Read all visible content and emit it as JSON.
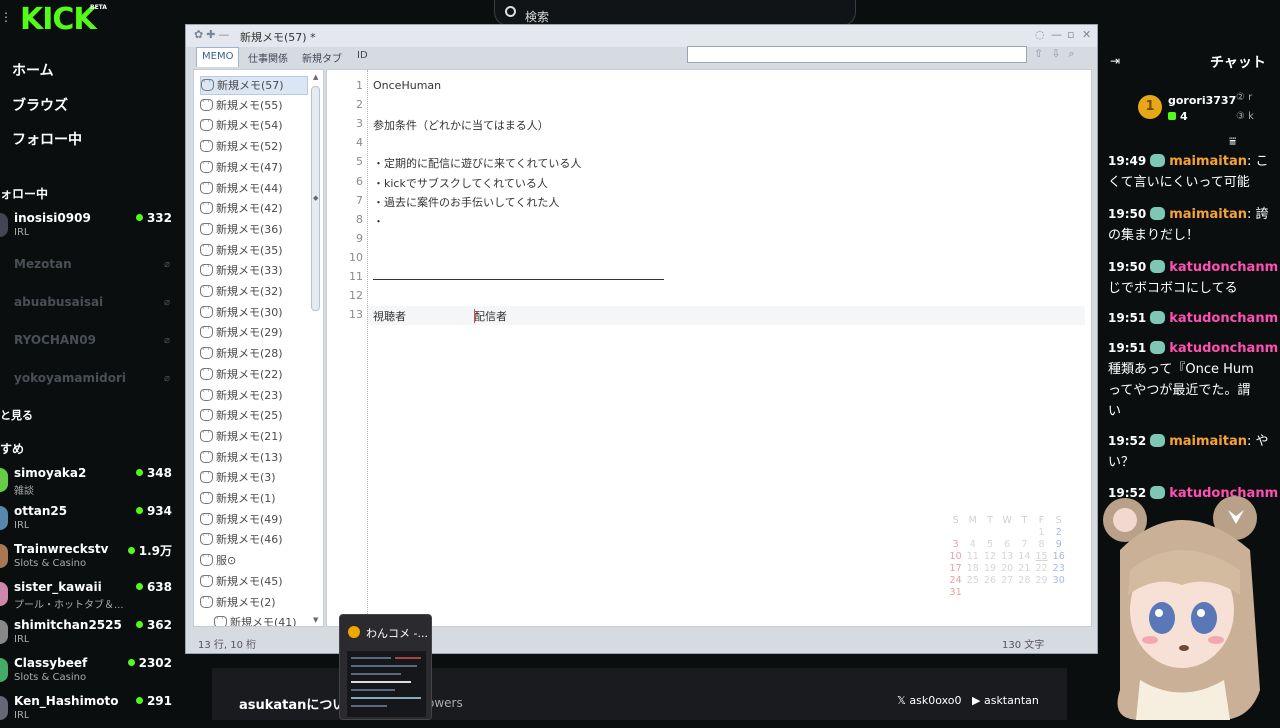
{
  "topbar": {
    "search_label": "検索"
  },
  "sidebar": {
    "logo": "KICK",
    "logo_badge": "BETA",
    "nav": [
      "ホーム",
      "ブラウズ",
      "フォロー中"
    ],
    "following_title": "ォロー中",
    "following": [
      {
        "name": "inosisi0909",
        "category": "IRL",
        "viewers": "332",
        "live": true
      },
      {
        "name": "Mezotan",
        "live": false
      },
      {
        "name": "abuabusaisai",
        "live": false
      },
      {
        "name": "RYOCHAN09",
        "live": false
      },
      {
        "name": "yokoyamamidori",
        "live": false
      }
    ],
    "show_more": "と見る",
    "recommended_title": "すめ",
    "recommended": [
      {
        "name": "simoyaka2",
        "category": "雑談",
        "viewers": "348"
      },
      {
        "name": "ottan25",
        "category": "IRL",
        "viewers": "934"
      },
      {
        "name": "Trainwreckstv",
        "category": "Slots & Casino",
        "viewers": "1.9万"
      },
      {
        "name": "sister_kawaii",
        "category": "プール・ホットタブ＆...",
        "viewers": "638"
      },
      {
        "name": "shimitchan2525",
        "category": "IRL",
        "viewers": "362"
      },
      {
        "name": "Classybeef",
        "category": "Slots & Casino",
        "viewers": "2302"
      },
      {
        "name": "Ken_Hashimoto",
        "category": "IRL",
        "viewers": "291"
      }
    ]
  },
  "memo_app": {
    "title": "新規メモ(57) *",
    "tabs": [
      "MEMO",
      "仕事関係",
      "新規タブ",
      "ID"
    ],
    "search_value": "",
    "list": [
      "新規メモ(57)",
      "新規メモ(55)",
      "新規メモ(54)",
      "新規メモ(52)",
      "新規メモ(47)",
      "新規メモ(44)",
      "新規メモ(42)",
      "新規メモ(36)",
      "新規メモ(35)",
      "新規メモ(33)",
      "新規メモ(32)",
      "新規メモ(30)",
      "新規メモ(29)",
      "新規メモ(28)",
      "新規メモ(22)",
      "新規メモ(23)",
      "新規メモ(25)",
      "新規メモ(21)",
      "新規メモ(13)",
      "新規メモ(3)",
      "新規メモ(1)",
      "新規メモ(49)",
      "新規メモ(46)",
      "服⊙",
      "新規メモ(45)",
      "新規メモ(2)",
      "新規メモ(41)"
    ],
    "editor_lines": [
      "OnceHuman",
      "",
      "参加条件（どれかに当てはまる人）",
      "",
      "・定期的に配信に遊びに来てくれている人",
      "・kickでサブスクしてくれている人",
      "・過去に案件のお手伝いしてくれた人",
      "・",
      "",
      "",
      "",
      "",
      "視聴者　　　　　配信者"
    ],
    "line13_left": "視聴者",
    "line13_right": "配信者",
    "calendar": {
      "headers": [
        "S",
        "M",
        "T",
        "W",
        "T",
        "F",
        "S"
      ],
      "days": [
        "",
        "",
        "",
        "",
        "",
        "1",
        "2",
        "3",
        "4",
        "5",
        "6",
        "7",
        "8",
        "9",
        "10",
        "11",
        "12",
        "13",
        "14",
        "15",
        "16",
        "17",
        "18",
        "19",
        "20",
        "21",
        "22",
        "23",
        "24",
        "25",
        "26",
        "27",
        "28",
        "29",
        "30",
        "31",
        "",
        "",
        "",
        "",
        "",
        ""
      ]
    },
    "status_left": "13 行, 10 桁",
    "status_right": "130 文字"
  },
  "taskbar_preview": {
    "title": "わんコメ -..."
  },
  "about": {
    "title": "asukatanについ",
    "followers": "owers",
    "x_handle": "ask0oxo0",
    "yt_handle": "asktantan"
  },
  "chat": {
    "header": "チャット",
    "pinned": {
      "rank": "1",
      "name": "gorori3737",
      "count": "4"
    },
    "messages": [
      {
        "time": "19:49",
        "user": "maimaitan",
        "color": "orange",
        "text": ": こ",
        "cont": [
          "くて言いにくいって可能"
        ]
      },
      {
        "time": "19:50",
        "user": "maimaitan",
        "color": "orange",
        "text": ": 誇",
        "cont": [
          "の集まりだし！"
        ]
      },
      {
        "time": "19:50",
        "user": "katudonchanm",
        "color": "pink",
        "text": "",
        "cont": [
          "じでボコボコにしてる"
        ]
      },
      {
        "time": "19:51",
        "user": "katudonchanm",
        "color": "pink",
        "text": "",
        "cont": []
      },
      {
        "time": "19:51",
        "user": "katudonchanm",
        "color": "pink",
        "text": "",
        "cont": [
          "種類あって『Once Hum",
          "ってやつが最近でた。謂",
          "い"
        ]
      },
      {
        "time": "19:52",
        "user": "maimaitan",
        "color": "orange",
        "text": ": や",
        "cont": [
          "い？"
        ]
      },
      {
        "time": "19:52",
        "user": "katudonchanm",
        "color": "pink",
        "text": "",
        "cont": []
      }
    ]
  }
}
